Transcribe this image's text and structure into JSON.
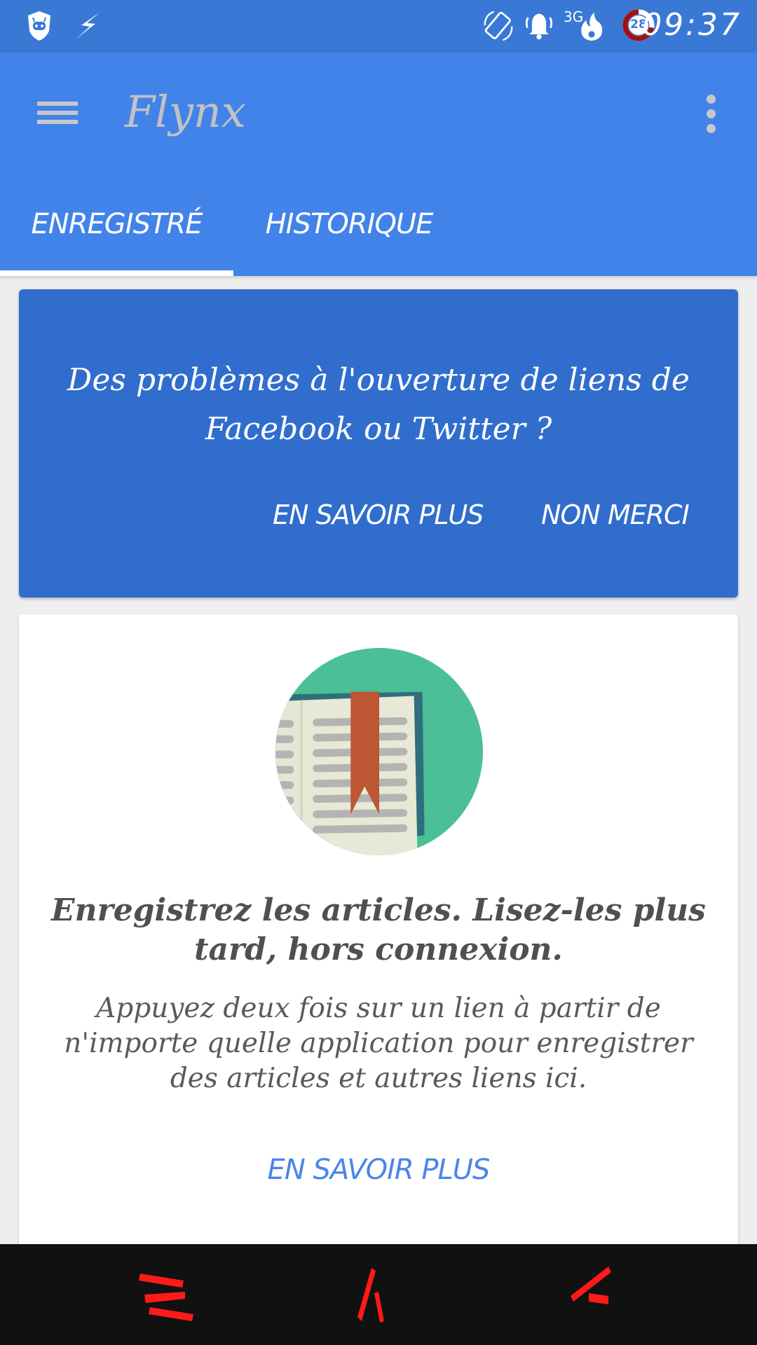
{
  "status_bar": {
    "time": "09:37",
    "battery_level": "28",
    "network": "3G",
    "icons": [
      "cyanogen-shield-icon",
      "flash-icon",
      "auto-rotate-icon",
      "alarm-bell-icon",
      "3g-signal-icon",
      "fire-icon",
      "battery-ring-icon"
    ],
    "battery_color": "#a50f0f"
  },
  "toolbar": {
    "title": "Flynx",
    "menu_icon": "hamburger-menu-icon",
    "overflow_icon": "more-vertical-icon"
  },
  "tabs": [
    {
      "label": "ENREGISTRÉ",
      "selected": true
    },
    {
      "label": "HISTORIQUE",
      "selected": false
    }
  ],
  "banner": {
    "message": "Des problèmes à l'ouverture de liens de Facebook ou Twitter ?",
    "learn_more": "EN SAVOIR PLUS",
    "dismiss": "NON MERCI"
  },
  "empty_state": {
    "illustration": "open-book-bookmark-icon",
    "title": "Enregistrez les articles. Lisez-les plus tard, hors connexion.",
    "body": "Appuyez deux fois sur un lien à partir de n'importe quelle application pour enregistrer des articles et autres liens ici.",
    "link": "EN SAVOIR PLUS"
  },
  "nav_bar": {
    "buttons": [
      "menu-nav-icon",
      "home-nav-icon",
      "back-nav-icon"
    ]
  },
  "colors": {
    "status_bar": "#3a78d6",
    "primary": "#4283ea",
    "banner": "#306dcd",
    "link": "#4a86e8",
    "nav_icons": "#ff1a1a",
    "illustration_bg": "#4bbf96"
  }
}
